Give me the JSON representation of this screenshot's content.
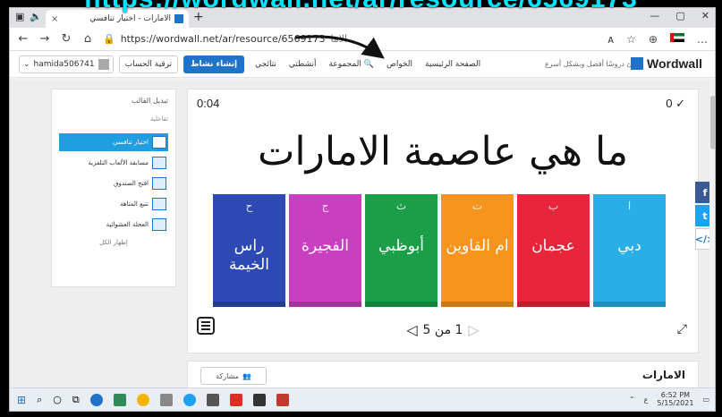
{
  "overlay_url": "https://wordwall.net/ar/resource/6569173",
  "browser": {
    "tab_title": "الامارات - اختيار تنافسي",
    "url": "https://wordwall.net/ar/resource/6569173",
    "url_suffix": "الاما..."
  },
  "header": {
    "user": "hamida506741",
    "upgrade_label": "ترقية الحساب",
    "create_label": "إنشاء نشاط",
    "nav": [
      "الصفحة الرئيسية",
      "الخواص",
      "المجموعة",
      "أنشطتي",
      "نتائجي"
    ],
    "tagline": "أنشئ دروسًا أفضل وبشكل أسرع",
    "logo": "Wordwall"
  },
  "side": {
    "title": "تبديل القالب",
    "subtitle": "تفاعلية",
    "items": [
      "اختيار تنافسي",
      "مسابقة الألعاب التلفزية",
      "افتح الصندوق",
      "تتبع المتاهة",
      "العجلة العشوائية"
    ],
    "more": "إظهار الكل"
  },
  "game": {
    "timer": "0:04",
    "score": "0 ✓",
    "question": "ما هي عاصمة الامارات",
    "answers": [
      {
        "letter": "ا",
        "text": "دبي",
        "color": "#29aee6"
      },
      {
        "letter": "ب",
        "text": "عجمان",
        "color": "#e8253b"
      },
      {
        "letter": "ت",
        "text": "ام القاوين",
        "color": "#f7941d"
      },
      {
        "letter": "ث",
        "text": "أبوظبي",
        "color": "#1a9f48"
      },
      {
        "letter": "ج",
        "text": "الفجيرة",
        "color": "#c83fbf"
      },
      {
        "letter": "ح",
        "text": "راس الخيمة",
        "color": "#2d49b4"
      }
    ],
    "pager": "1 من 5"
  },
  "info": {
    "share_label": "مشاركة",
    "activity_title": "الامارات"
  },
  "taskbar": {
    "time": "6:52 PM",
    "date": "5/15/2021"
  }
}
